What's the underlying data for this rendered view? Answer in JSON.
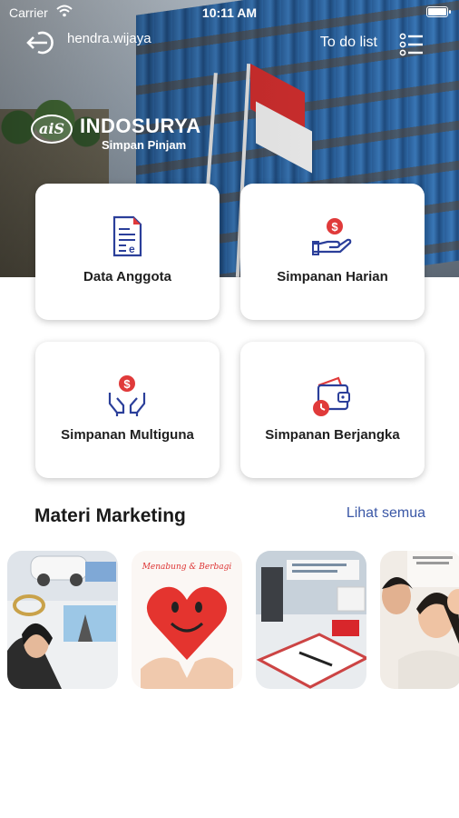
{
  "status_bar": {
    "carrier": "Carrier",
    "time": "10:11 AM",
    "battery_level": 1.0
  },
  "header": {
    "username": "hendra.wijaya",
    "todo_label": "To do list"
  },
  "logo": {
    "mark": "aiS",
    "name": "INDOSURYA",
    "subtitle": "Simpan Pinjam"
  },
  "menu": [
    {
      "label": "Data Anggota",
      "icon": "document-icon"
    },
    {
      "label": "Simpanan Harian",
      "icon": "hand-coin-icon"
    },
    {
      "label": "Simpanan Multiguna",
      "icon": "two-hands-coin-icon"
    },
    {
      "label": "Simpanan Berjangka",
      "icon": "wallet-clock-icon"
    }
  ],
  "marketing": {
    "title": "Materi Marketing",
    "see_all": "Lihat semua",
    "banners": [
      {
        "icon": "marketing-banner-lifestyle"
      },
      {
        "icon": "marketing-banner-heart",
        "text": "Menabung & Berbagi"
      },
      {
        "icon": "marketing-banner-office"
      },
      {
        "icon": "marketing-banner-family"
      }
    ]
  },
  "colors": {
    "accent_blue": "#2b3f9a",
    "accent_red": "#e03a3a",
    "link": "#3a57a6"
  }
}
